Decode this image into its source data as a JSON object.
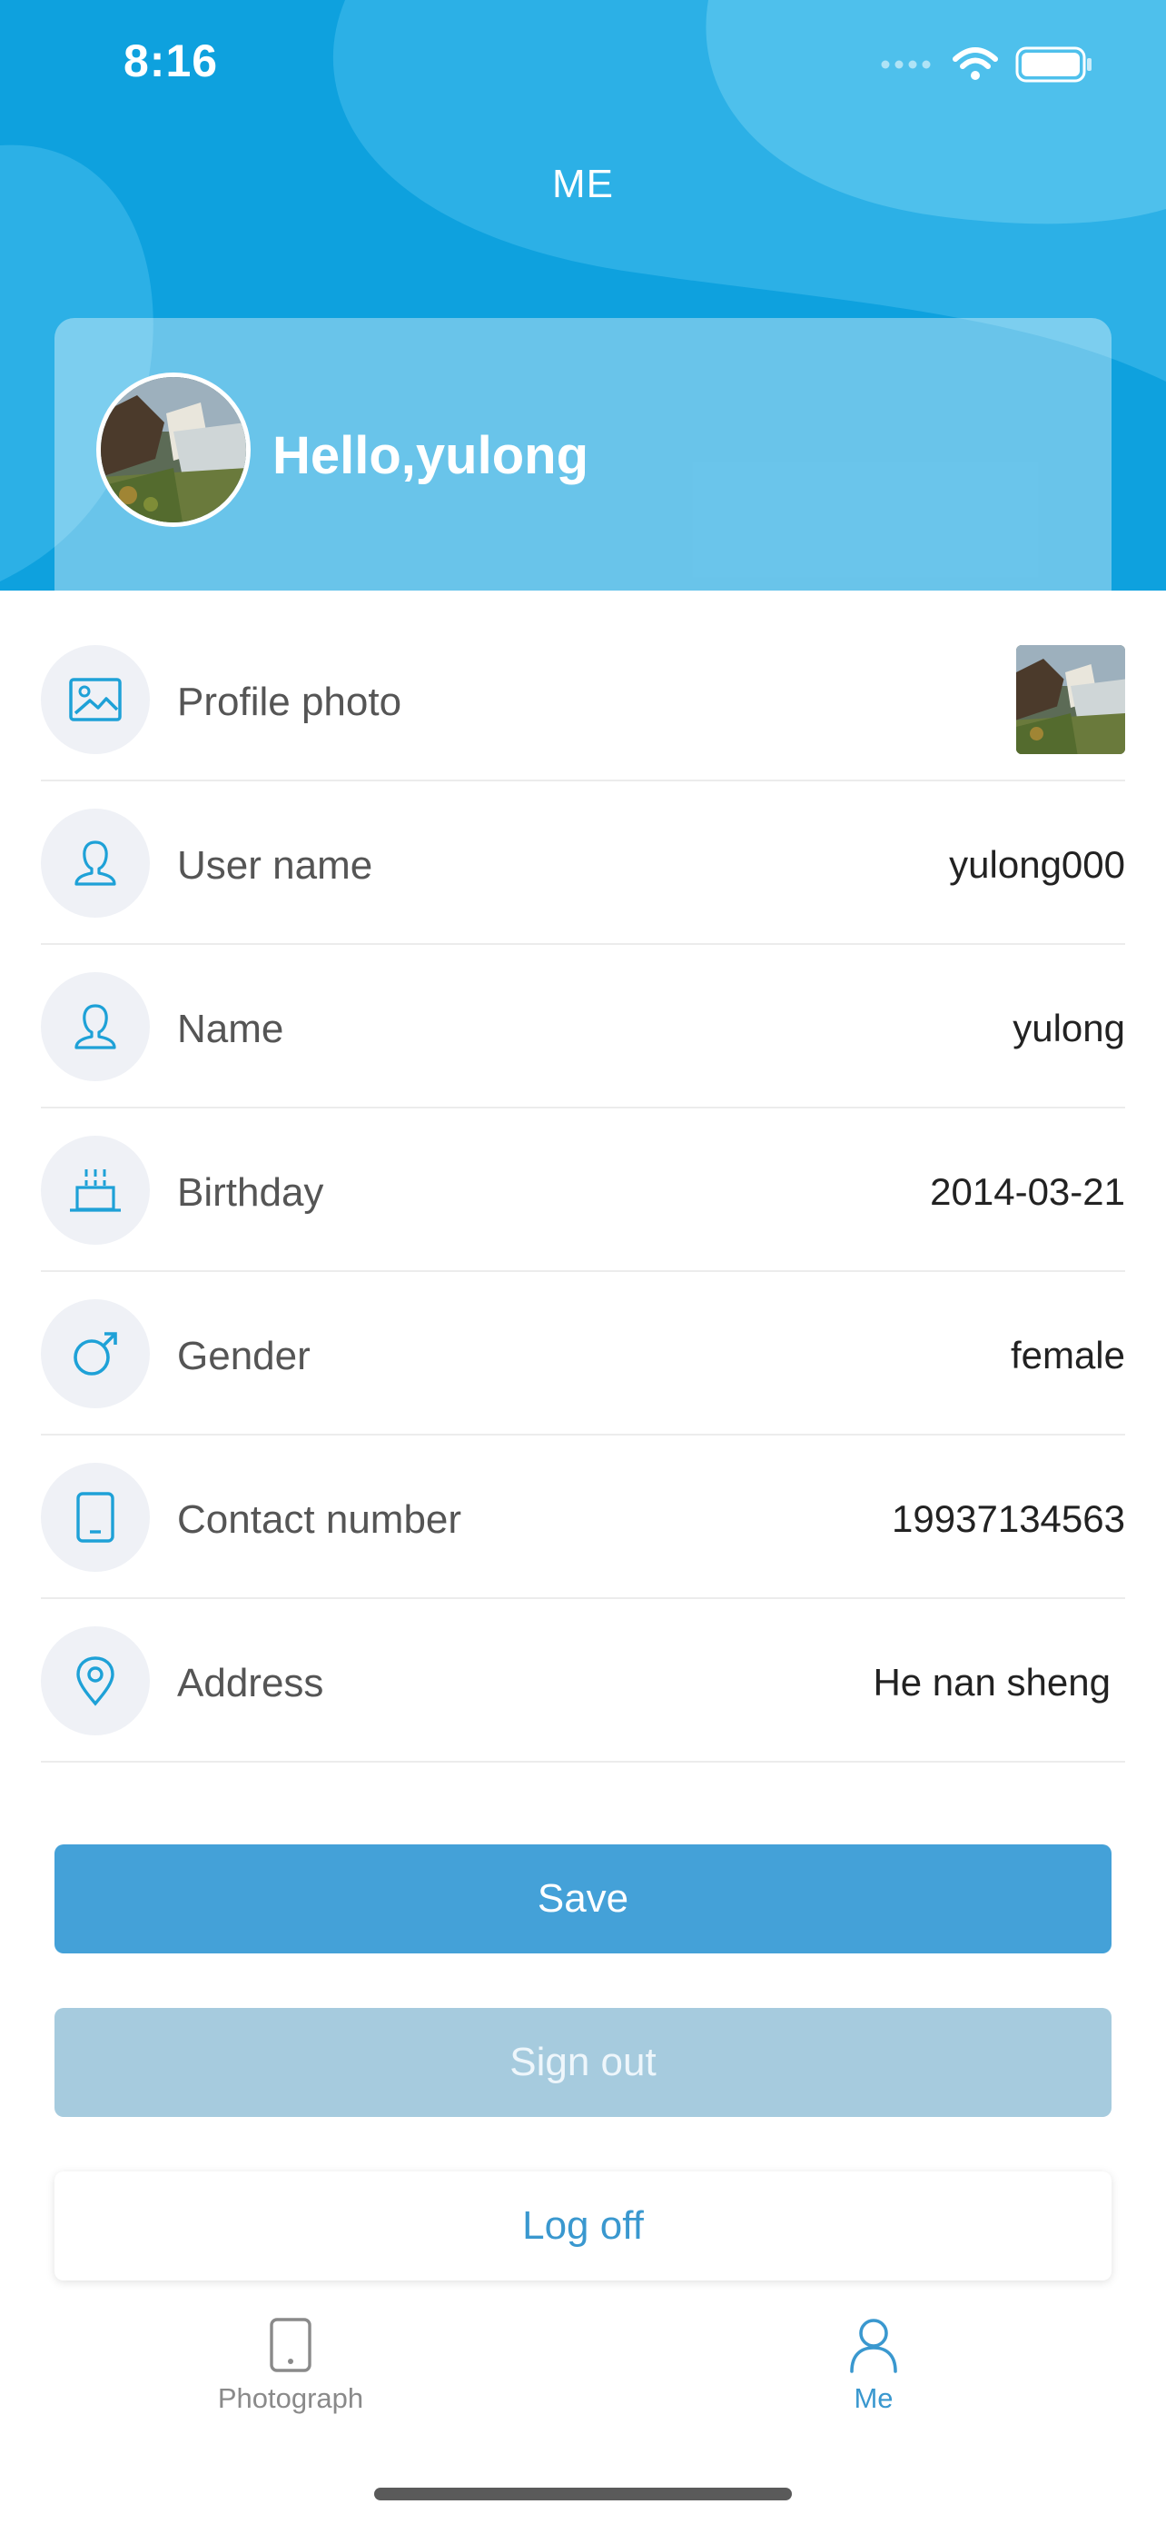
{
  "status_bar": {
    "time": "8:16"
  },
  "header": {
    "title": "ME",
    "greeting": "Hello,yulong"
  },
  "colors": {
    "header_bg": "#0ea1de",
    "accent": "#44a1d8",
    "signout_bg": "#a6cbde",
    "icon_blue": "#1ea1d7"
  },
  "profile_list": [
    {
      "label": "Profile photo",
      "value": "",
      "icon": "image-icon"
    },
    {
      "label": "User name",
      "value": "yulong000",
      "icon": "user-icon"
    },
    {
      "label": "Name",
      "value": "yulong",
      "icon": "user-icon"
    },
    {
      "label": "Birthday",
      "value": "2014-03-21",
      "icon": "cake-icon"
    },
    {
      "label": "Gender",
      "value": "female",
      "icon": "male-gender-icon"
    },
    {
      "label": "Contact number",
      "value": "19937134563",
      "icon": "tablet-icon"
    },
    {
      "label": "Address",
      "value": "He nan sheng",
      "icon": "location-pin-icon"
    }
  ],
  "buttons": {
    "save": "Save",
    "sign_out": "Sign out",
    "log_off": "Log off"
  },
  "tabbar": {
    "items": [
      {
        "label": "Photograph",
        "icon": "phone-icon",
        "active": false
      },
      {
        "label": "Me",
        "icon": "person-icon",
        "active": true
      }
    ]
  }
}
